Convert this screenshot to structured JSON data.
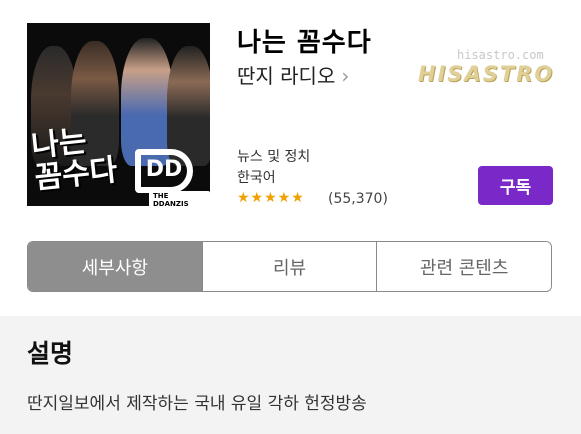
{
  "app": {
    "title": "나는 꼼수다",
    "publisher": "딴지 라디오",
    "category": "뉴스 및 정치",
    "language": "한국어",
    "stars": "★★★★★",
    "rating_count": "(55,370)",
    "subscribe_label": "구독"
  },
  "artwork": {
    "title_line1": "나는",
    "title_line2": "꼼수다",
    "logo_text": "DD",
    "logo_tag": "THE DDANZIS"
  },
  "watermark": {
    "url": "hisastro.com",
    "name": "HISASTRO"
  },
  "tabs": [
    {
      "label": "세부사항",
      "active": true
    },
    {
      "label": "리뷰",
      "active": false
    },
    {
      "label": "관련 콘텐츠",
      "active": false
    }
  ],
  "description": {
    "heading": "설명",
    "text": "딴지일보에서 제작하는 국내 유일 각하 헌정방송"
  },
  "colors": {
    "accent": "#7a28c8",
    "star": "#f0a000",
    "active_tab": "#8e8e8e"
  }
}
